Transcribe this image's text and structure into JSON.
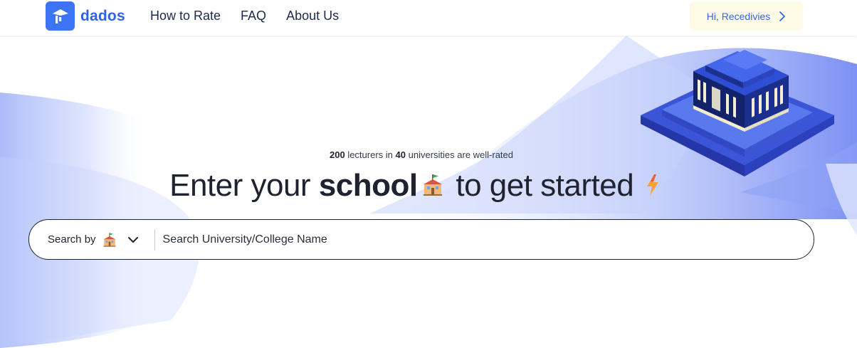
{
  "colors": {
    "brand": "#3d73f5",
    "brand_text": "#2f62e8",
    "user_button_bg": "#fdfbe6",
    "user_button_text": "#3566e6",
    "text_dark": "#1f2330"
  },
  "header": {
    "brand_name": "dados",
    "logo_icon": "graduation-cap-icon",
    "nav": [
      {
        "label": "How to Rate"
      },
      {
        "label": "FAQ"
      },
      {
        "label": "About Us"
      }
    ],
    "user_button": {
      "label": "Hi, Recedivies",
      "icon": "chevron-right-icon"
    }
  },
  "hero": {
    "stats": {
      "lecturers_count": "200",
      "lecturers_text": "lecturers in",
      "universities_count": "40",
      "universities_text": "universities are well-rated"
    },
    "headline": {
      "part1": "Enter your",
      "highlight": "school",
      "emoji_1": "school-emoji-icon",
      "part2": "to get started",
      "emoji_2": "lightning-emoji-icon"
    },
    "illustration": "isometric-building-icon"
  },
  "search": {
    "search_by_label": "Search by",
    "search_by_icon": "school-emoji-icon",
    "dropdown_icon": "chevron-down-icon",
    "placeholder": "Search University/College Name",
    "value": ""
  }
}
